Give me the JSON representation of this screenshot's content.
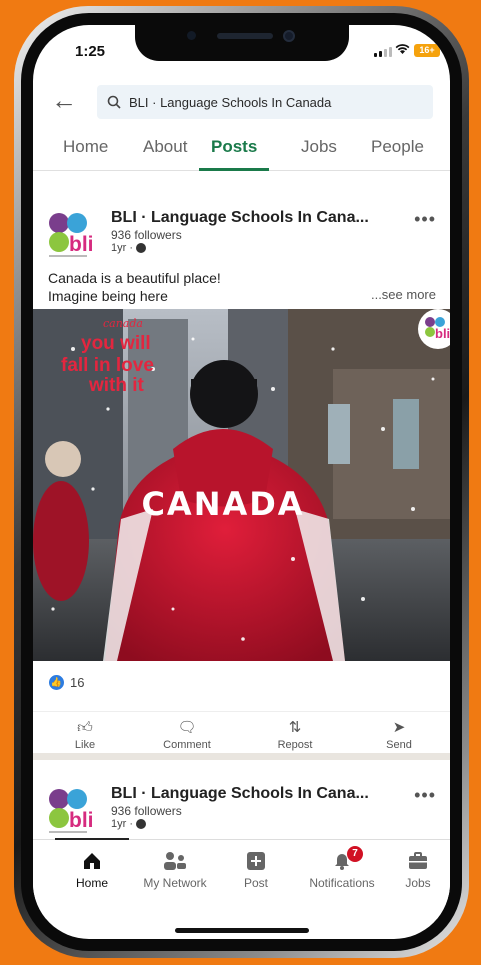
{
  "status_bar": {
    "time": "1:25",
    "battery": "16+"
  },
  "search": {
    "query": "BLI · Language Schools In Canada"
  },
  "tabs": [
    {
      "label": "Home"
    },
    {
      "label": "About"
    },
    {
      "label": "Posts",
      "active": true
    },
    {
      "label": "Jobs"
    },
    {
      "label": "People"
    }
  ],
  "posts": [
    {
      "company": "BLI · Language Schools In Cana...",
      "followers": "936 followers",
      "age": "1yr ·",
      "caption_line1": "Canada is a beautiful place!",
      "caption_line2": "Imagine being here",
      "see_more": "...see more",
      "image_overlay": {
        "small": "canada",
        "line1": "you will",
        "line2": "fall in love",
        "line3": "with it",
        "jacket": "CANADA"
      },
      "reaction_count": "16"
    },
    {
      "company": "BLI · Language Schools In Cana...",
      "followers": "936 followers",
      "age": "1yr ·"
    }
  ],
  "logo_text": "bli",
  "actions": [
    {
      "label": "Like",
      "icon": "thumbs-up-icon"
    },
    {
      "label": "Comment",
      "icon": "comment-icon"
    },
    {
      "label": "Repost",
      "icon": "repost-icon"
    },
    {
      "label": "Send",
      "icon": "send-icon"
    }
  ],
  "bottom_nav": [
    {
      "label": "Home",
      "icon": "home-icon",
      "active": true
    },
    {
      "label": "My Network",
      "icon": "network-icon"
    },
    {
      "label": "Post",
      "icon": "post-icon"
    },
    {
      "label": "Notifications",
      "icon": "bell-icon",
      "badge": "7"
    },
    {
      "label": "Jobs",
      "icon": "briefcase-icon"
    }
  ],
  "colors": {
    "accent_green": "#1a7a4a",
    "background_orange": "#f07a12",
    "jacket_red": "#c8102e",
    "like_blue": "#2d7ce0",
    "badge_red": "#d11124"
  }
}
